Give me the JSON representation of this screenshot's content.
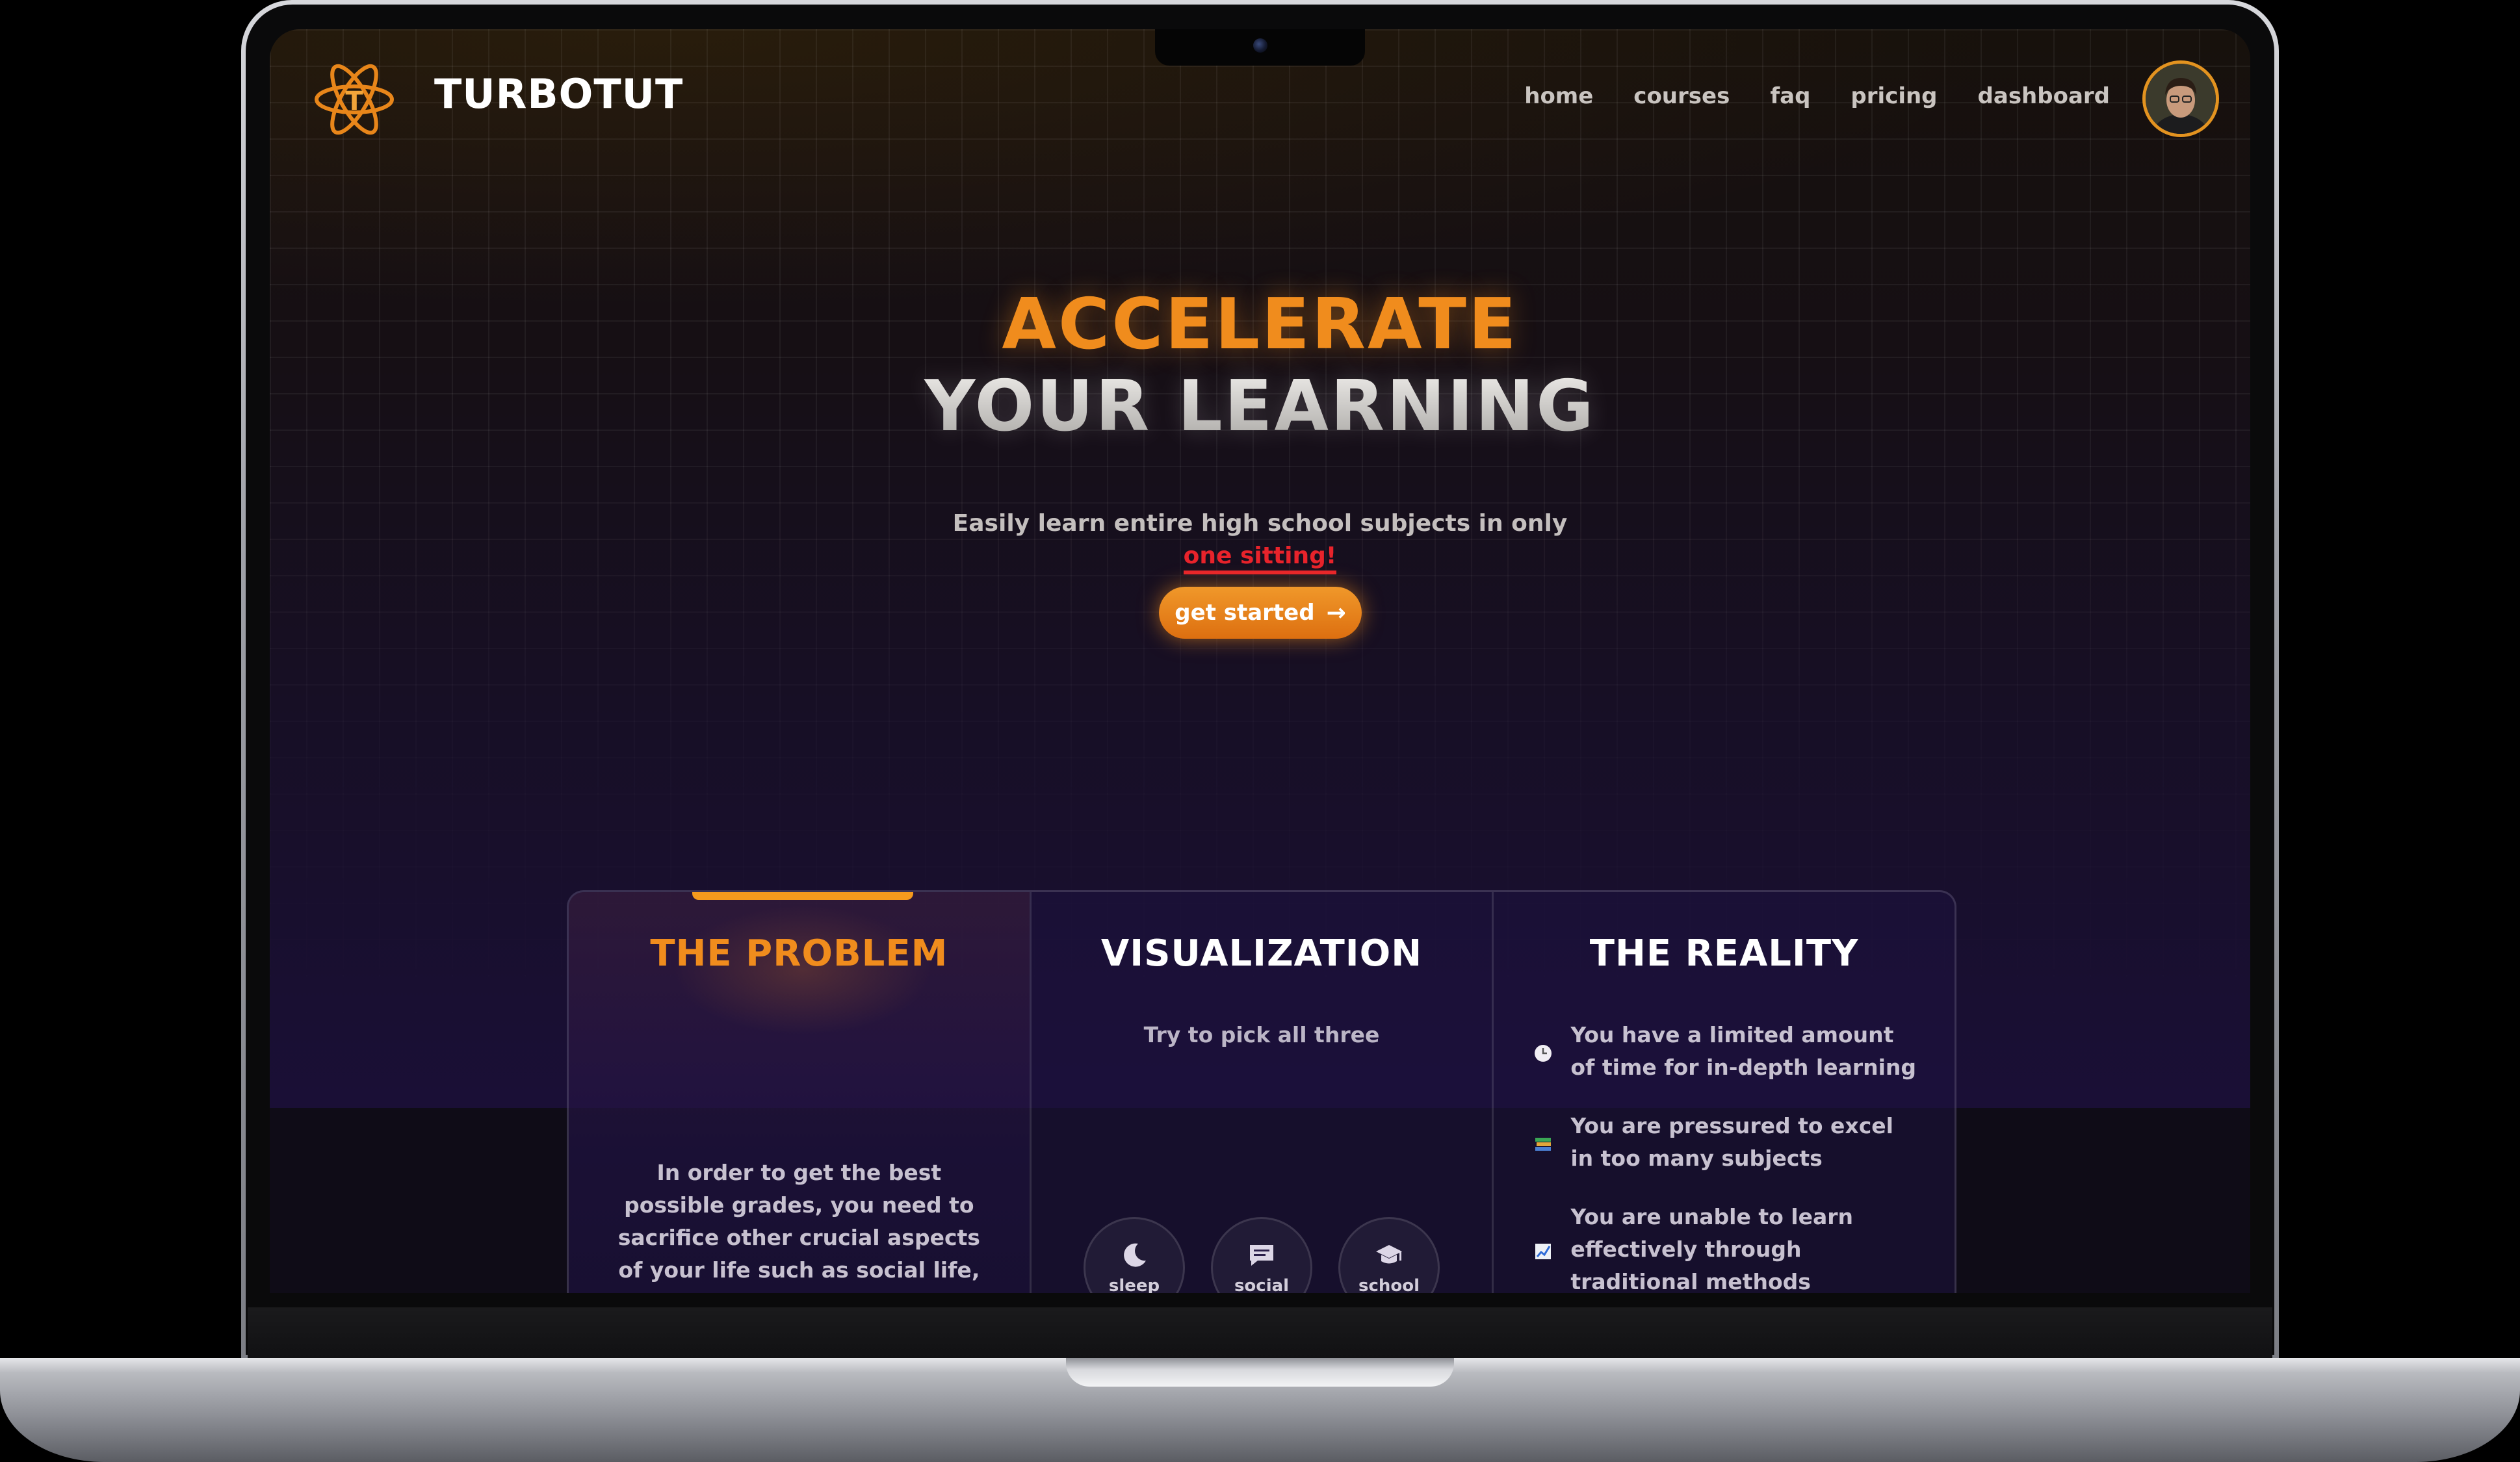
{
  "brand": {
    "name": "TURBOTUT",
    "logo_icon": "atom-logo-icon",
    "accent": "#f08c1d"
  },
  "nav": {
    "items": [
      {
        "label": "home"
      },
      {
        "label": "courses"
      },
      {
        "label": "faq"
      },
      {
        "label": "pricing"
      },
      {
        "label": "dashboard"
      }
    ]
  },
  "hero": {
    "title_line1": "ACCELERATE",
    "title_line2": "YOUR LEARNING",
    "subtitle": "Easily learn entire high school subjects in only",
    "highlight": "one sitting!",
    "cta_label": "get started",
    "cta_icon": "arrow-right-icon"
  },
  "cards": {
    "problem": {
      "title": "THE PROBLEM",
      "text": "In order to get the best possible grades, you need to sacrifice other crucial aspects of your life such as social life, or sleep"
    },
    "visualization": {
      "title": "VISUALIZATION",
      "subtitle": "Try to pick all three",
      "options": [
        {
          "label": "sleep",
          "icon": "moon-icon"
        },
        {
          "label": "social",
          "icon": "chat-icon"
        },
        {
          "label": "school",
          "icon": "graduation-cap-icon"
        }
      ]
    },
    "reality": {
      "title": "THE REALITY",
      "items": [
        {
          "text": "You have a limited amount of time for in-depth learning",
          "icon": "clock-icon"
        },
        {
          "text": "You are pressured to excel in too many subjects",
          "icon": "books-icon"
        },
        {
          "text": "You are unable to learn effectively through traditional methods",
          "icon": "chart-icon"
        }
      ]
    }
  }
}
